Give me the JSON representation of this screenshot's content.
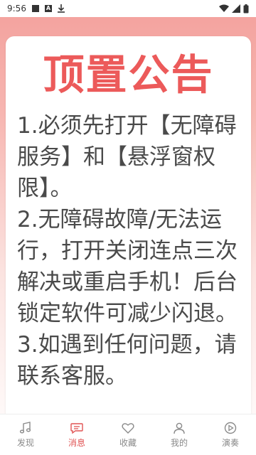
{
  "status_bar": {
    "time": "9:56",
    "icons": [
      "notification-square-icon",
      "a-icon",
      "download-icon",
      "wifi-icon",
      "signal-icon",
      "battery-icon"
    ]
  },
  "notice": {
    "title": "顶置公告",
    "paragraphs": [
      "1.必须先打开【无障碍服务】和【悬浮窗权限】。",
      "2.无障碍故障/无法运行，打开关闭连点三次解决或重启手机！后台锁定软件可减少闪退。",
      "3.如遇到任何问题，请联系客服。"
    ]
  },
  "bottom_nav": {
    "items": [
      {
        "label": "发现",
        "icon": "music-note-icon",
        "active": false
      },
      {
        "label": "消息",
        "icon": "message-bubble-icon",
        "active": true
      },
      {
        "label": "收藏",
        "icon": "heart-icon",
        "active": false
      },
      {
        "label": "我的",
        "icon": "person-icon",
        "active": false
      },
      {
        "label": "演奏",
        "icon": "play-disc-icon",
        "active": false
      }
    ]
  },
  "colors": {
    "accent": "#e05454",
    "title_red": "#ec5a5a",
    "header_pink": "#f3a09c"
  }
}
